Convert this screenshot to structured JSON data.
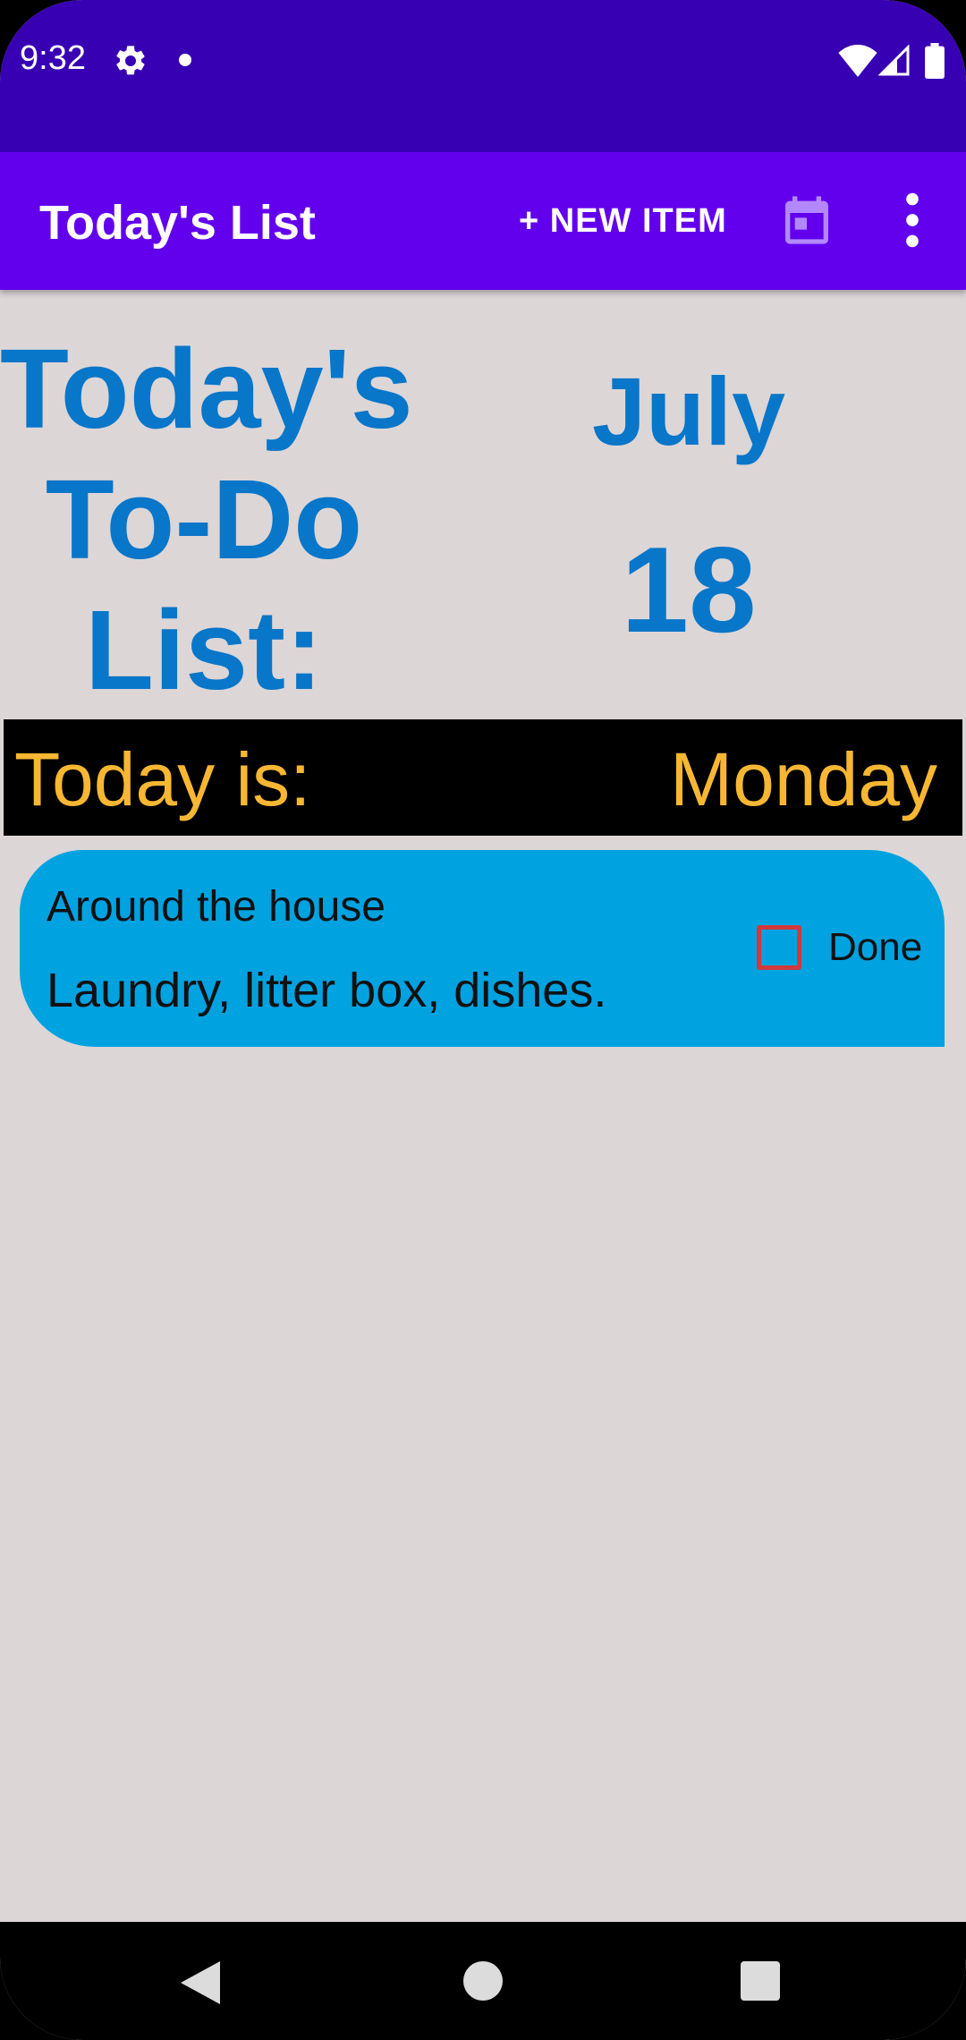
{
  "status_bar": {
    "time": "9:32",
    "background_color": "#3800b3",
    "icons": [
      "gear-icon",
      "notification-dot-icon",
      "wifi-icon",
      "signal-icon",
      "battery-icon"
    ]
  },
  "app_bar": {
    "title": "Today's List",
    "new_item_label": "+ NEW ITEM",
    "calendar_icon": "calendar-icon",
    "overflow_icon": "more-vert-icon",
    "background_color": "#6200ee"
  },
  "header": {
    "line1": "Today's",
    "line2": "To-Do",
    "line3": "List:",
    "month": "July",
    "day": "18",
    "text_color": "#0876c9"
  },
  "today_bar": {
    "label": "Today is:",
    "weekday": "Monday",
    "text_color": "#f7b733",
    "background_color": "#000000"
  },
  "tasks": [
    {
      "category": "Around the house",
      "description": "Laundry, litter box, dishes.",
      "done_label": "Done",
      "done": false,
      "card_color": "#00a2e0"
    }
  ],
  "nav_bar": {
    "icons": [
      "back-icon",
      "home-icon",
      "recents-icon"
    ]
  },
  "colors": {
    "content_background": "#dcd6d7",
    "checkbox_border": "#d03a3a"
  }
}
